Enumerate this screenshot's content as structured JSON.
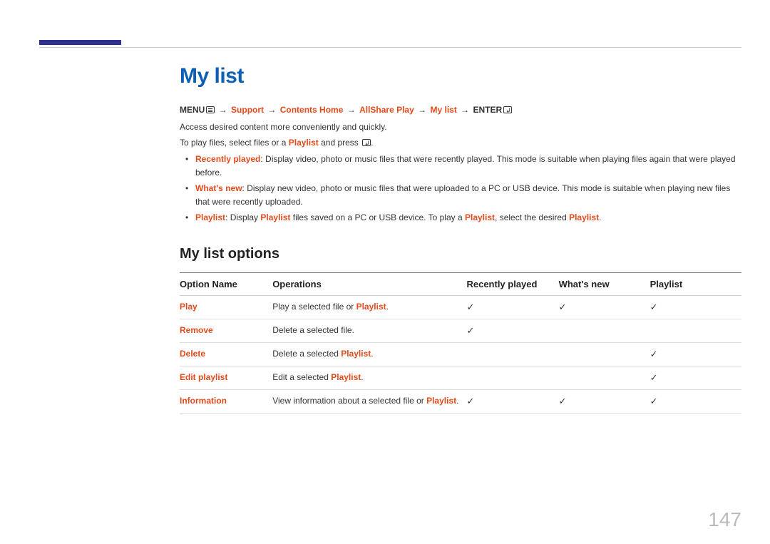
{
  "heading": "My list",
  "nav": {
    "menu": "MENU",
    "arrow": "→",
    "support": "Support",
    "contents_home": "Contents Home",
    "allshare": "AllShare Play",
    "my_list": "My list",
    "enter": "ENTER"
  },
  "intro": {
    "line1": "Access desired content more conveniently and quickly.",
    "line2_a": "To play files, select files or a ",
    "line2_b": "Playlist",
    "line2_c": " and press "
  },
  "bullets": [
    {
      "label": "Recently played",
      "text": ": Display video, photo or music files that were recently played. This mode is suitable when playing files again that were played before."
    },
    {
      "label": "What's new",
      "text": ": Display new video, photo or music files that were uploaded to a PC or USB device. This mode is suitable when playing new files that were recently uploaded."
    }
  ],
  "bullet3": {
    "a": "Playlist",
    "b": ": Display ",
    "c": "Playlist",
    "d": " files saved on a PC or USB device. To play a ",
    "e": "Playlist",
    "f": ", select the desired ",
    "g": "Playlist",
    "h": "."
  },
  "subheading": "My list options",
  "table": {
    "headers": [
      "Option Name",
      "Operations",
      "Recently played",
      "What's new",
      "Playlist"
    ],
    "rows": [
      {
        "name": "Play",
        "op_a": "Play a selected file or ",
        "op_red": "Playlist",
        "op_b": ".",
        "rp": "✓",
        "wn": "✓",
        "pl": "✓"
      },
      {
        "name": "Remove",
        "op_a": "Delete a selected file.",
        "op_red": "",
        "op_b": "",
        "rp": "✓",
        "wn": "",
        "pl": ""
      },
      {
        "name": "Delete",
        "op_a": "Delete a selected ",
        "op_red": "Playlist",
        "op_b": ".",
        "rp": "",
        "wn": "",
        "pl": "✓"
      },
      {
        "name": "Edit playlist",
        "op_a": "Edit a selected ",
        "op_red": "Playlist",
        "op_b": ".",
        "rp": "",
        "wn": "",
        "pl": "✓"
      },
      {
        "name": "Information",
        "op_a": "View information about a selected file or ",
        "op_red": "Playlist",
        "op_b": ".",
        "rp": "✓",
        "wn": "✓",
        "pl": "✓"
      }
    ]
  },
  "page_number": "147"
}
